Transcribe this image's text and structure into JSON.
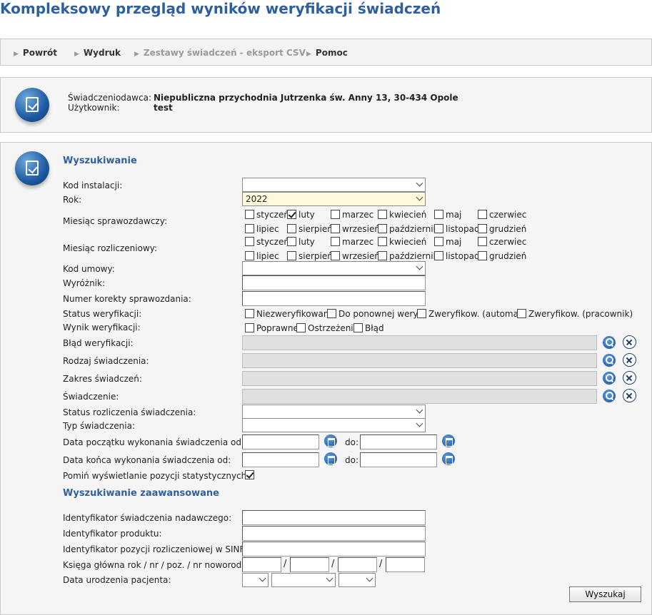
{
  "title": "Kompleksowy przegląd wyników weryfikacji świadczeń",
  "nav": {
    "back": "Powrót",
    "print": "Wydruk",
    "export": "Zestawy świadczeń - eksport CSV",
    "help": "Pomoc"
  },
  "info": {
    "provider_label": "Świadczeniodawca:",
    "provider_value": "Niepubliczna przychodnia Jutrzenka św. Anny 13, 30-434 Opole",
    "user_label": "Użytkownik:",
    "user_value": "test"
  },
  "search": {
    "heading": "Wyszukiwanie",
    "kod_instalacji_label": "Kod instalacji:",
    "kod_instalacji_value": "",
    "rok_label": "Rok:",
    "rok_value": "2022",
    "miesiac_sprawozdawczy_label": "Miesiąc sprawozdawczy:",
    "miesiac_rozliczeniowy_label": "Miesiąc rozliczeniowy:",
    "months": [
      "styczeń",
      "luty",
      "marzec",
      "kwiecień",
      "maj",
      "czerwiec",
      "lipiec",
      "sierpień",
      "wrzesień",
      "październik",
      "listopad",
      "grudzień"
    ],
    "sprawozdawczy_checked": [
      false,
      true,
      false,
      false,
      false,
      false,
      false,
      false,
      false,
      false,
      false,
      false
    ],
    "kod_umowy_label": "Kod umowy:",
    "wyroznik_label": "Wyróżnik:",
    "numer_korekty_label": "Numer korekty sprawozdania:",
    "status_weryfikacji_label": "Status weryfikacji:",
    "status_options": [
      "Niezweryfikowane",
      "Do ponownej weryf.",
      "Zweryfikow. (automat)",
      "Zweryfikow. (pracownik)"
    ],
    "wynik_weryfikacji_label": "Wynik weryfikacji:",
    "wynik_options": [
      "Poprawne",
      "Ostrzeżenie",
      "Błąd"
    ],
    "blad_label": "Błąd weryfikacji:",
    "rodzaj_label": "Rodzaj świadczenia:",
    "zakres_label": "Zakres świadczeń:",
    "swiadczenie_label": "Świadczenie:",
    "status_rozliczenia_label": "Status rozliczenia świadczenia:",
    "typ_label": "Typ świadczenia:",
    "data_poczatku_label": "Data początku wykonania świadczenia od:",
    "data_konca_label": "Data końca wykonania świadczenia od:",
    "do_label": "do:",
    "pomin_label": "Pomiń wyświetlanie pozycji statystycznych:",
    "pomin_checked": true
  },
  "advanced": {
    "heading": "Wyszukiwanie zaawansowane",
    "id_swiadczenia_label": "Identyfikator świadczenia nadawczego:",
    "id_produktu_label": "Identyfikator produktu:",
    "id_pozycji_label": "Identyfikator pozycji rozliczeniowej w SINFZ:",
    "ksiega_label": "Księga główna rok / nr / poz. / nr noworodka:",
    "slash": "/",
    "data_urodzenia_label": "Data urodzenia pacjenta:",
    "submit": "Wyszukaj"
  }
}
